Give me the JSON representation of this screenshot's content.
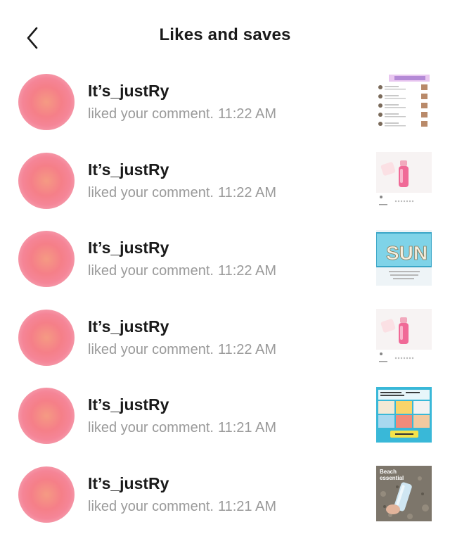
{
  "header": {
    "title": "Likes and saves",
    "back_icon": "chevron-left-icon"
  },
  "colors": {
    "avatar_gradient": [
      "#f59a83",
      "#f57f88",
      "#f5a6b5"
    ],
    "subtext": "#9a9a9a"
  },
  "notifications": [
    {
      "user": "It’s_justRy",
      "action": "liked your comment.",
      "time": "11:22 AM",
      "thumbnail": "comment-list-screenshot"
    },
    {
      "user": "It’s_justRy",
      "action": "liked your comment.",
      "time": "11:22 AM",
      "thumbnail": "pink-lip-gloss-post"
    },
    {
      "user": "It’s_justRy",
      "action": "liked your comment.",
      "time": "11:22 AM",
      "thumbnail": "sun-pouch-post"
    },
    {
      "user": "It’s_justRy",
      "action": "liked your comment.",
      "time": "11:22 AM",
      "thumbnail": "pink-lip-gloss-post"
    },
    {
      "user": "It’s_justRy",
      "action": "liked your comment.",
      "time": "11:21 AM",
      "thumbnail": "beach-items-collage"
    },
    {
      "user": "It’s_justRy",
      "action": "liked your comment.",
      "time": "11:21 AM",
      "thumbnail": "beach-essential-sunscreen"
    }
  ],
  "thumb_text": {
    "beach": [
      "Beach",
      "essential"
    ],
    "sun": "SUN"
  }
}
